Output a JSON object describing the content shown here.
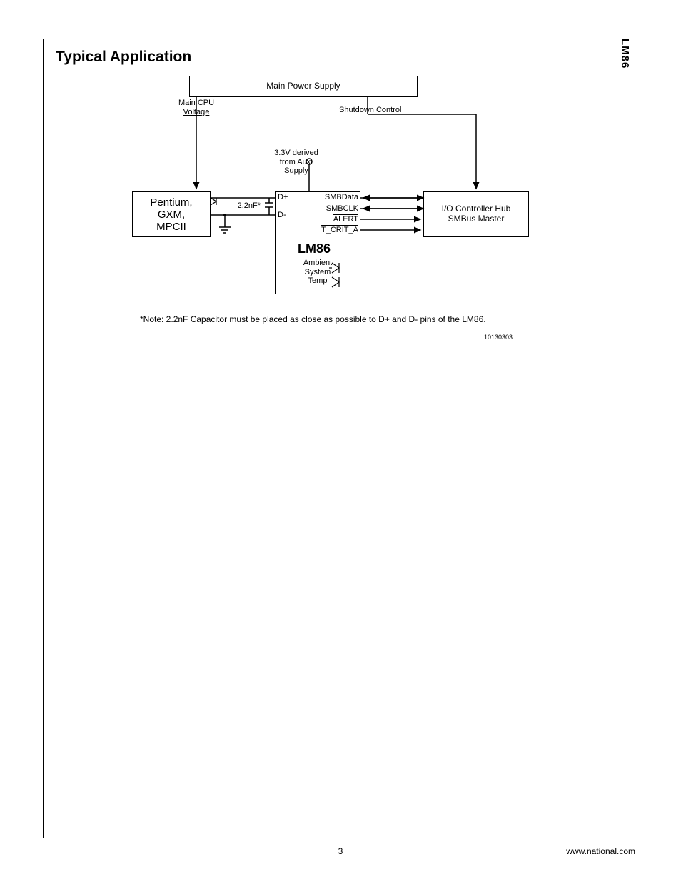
{
  "header": {
    "section_title": "Typical Application",
    "side_label": "LM86"
  },
  "diagram": {
    "power_supply": "Main Power Supply",
    "cpu_voltage_l1": "Main CPU",
    "cpu_voltage_l2": "Voltage",
    "shutdown": "Shutdown Control",
    "aux_l1": "3.3V  derived",
    "aux_l2": "from Aux.",
    "aux_l3": "Supply",
    "cpu_l1": "Pentium,",
    "cpu_l2": "GXM,",
    "cpu_l3": "MPCII",
    "cap": "2.2nF*",
    "d_plus": "D+",
    "d_minus": "D-",
    "smbdata": "SMBData",
    "smbclk": "SMBCLK",
    "alert": "ALERT",
    "tcrit": "T_CRIT_A",
    "chip": "LM86",
    "ambient_l1": "Ambient",
    "ambient_l2": "System",
    "ambient_l3": "Temp",
    "io_l1": "I/O Controller Hub",
    "io_l2": "SMBus Master"
  },
  "note": "*Note:  2.2nF Capacitor must be placed as close as possible to D+ and D- pins of the LM86.",
  "figure_id": "10130303",
  "footer": {
    "page": "3",
    "url": "www.national.com"
  }
}
